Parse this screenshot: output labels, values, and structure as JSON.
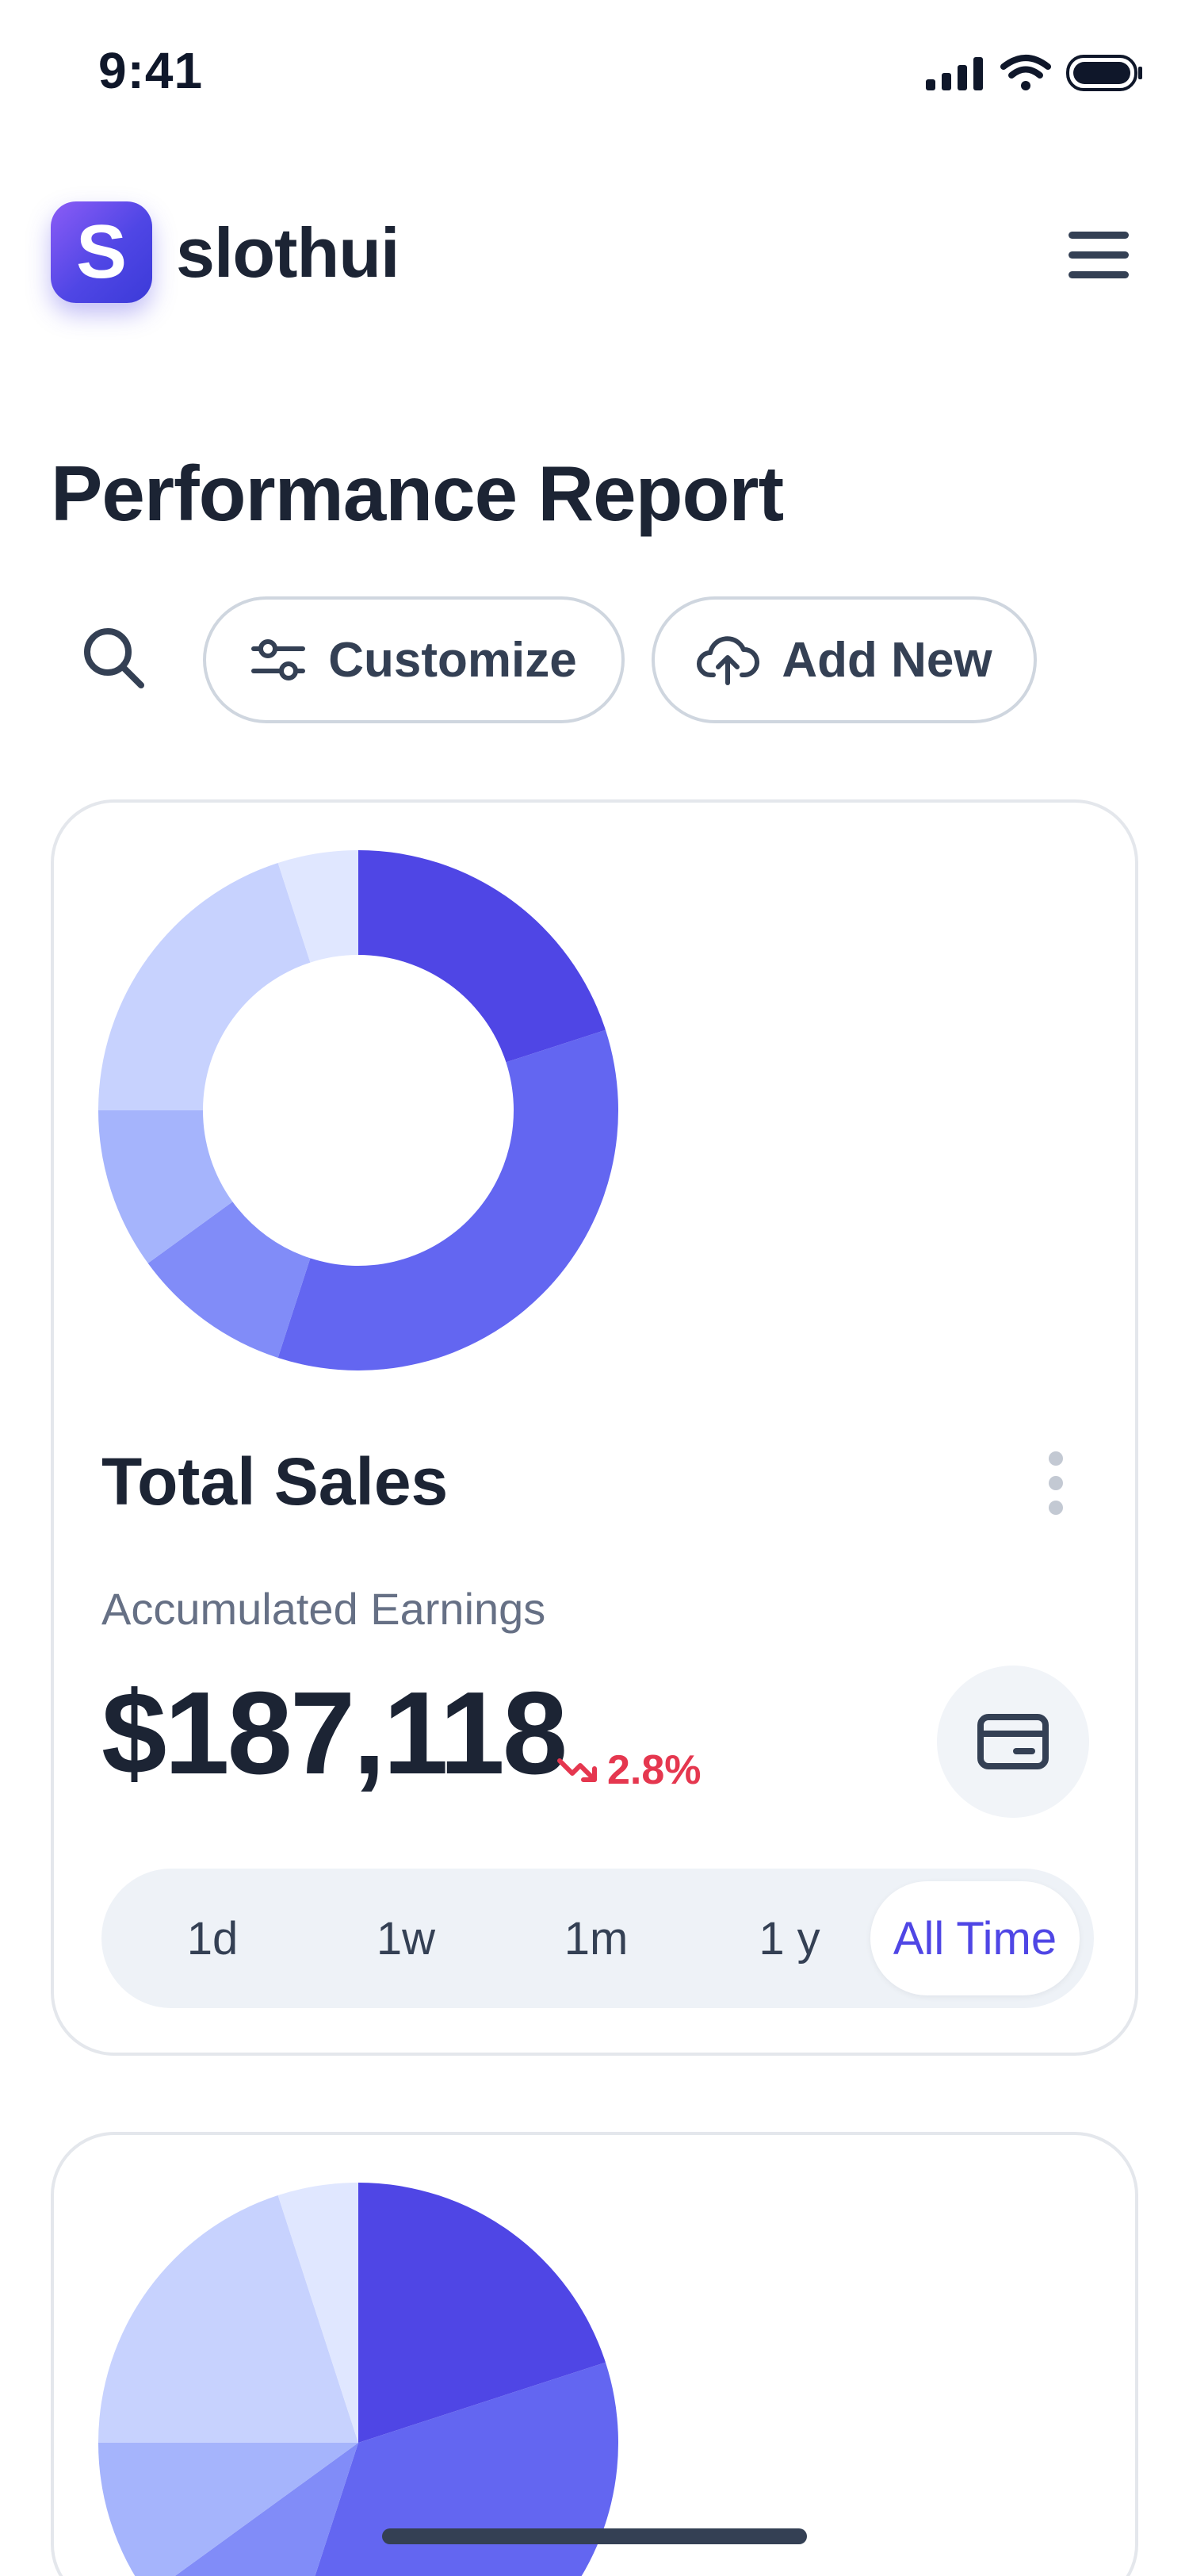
{
  "status_bar": {
    "time": "9:41"
  },
  "header": {
    "brand_letter": "S",
    "brand_name": "slothui"
  },
  "page": {
    "title": "Performance Report"
  },
  "toolbar": {
    "customize_label": "Customize",
    "add_new_label": "Add New"
  },
  "sales_card": {
    "title": "Total Sales",
    "subtitle": "Accumulated Earnings",
    "amount": "$187,118",
    "change": {
      "direction": "down",
      "value": "2.8%",
      "color": "#e5374f"
    },
    "time_ranges": [
      "1d",
      "1w",
      "1m",
      "1 y",
      "All Time"
    ],
    "selected_range": "All Time"
  },
  "chart_data": [
    {
      "type": "pie",
      "variant": "donut",
      "title": "",
      "slices": [
        {
          "value": 20,
          "color": "#4f46e5"
        },
        {
          "value": 35,
          "color": "#6366f1"
        },
        {
          "value": 10,
          "color": "#818cf8"
        },
        {
          "value": 10,
          "color": "#a5b4fc"
        },
        {
          "value": 20,
          "color": "#c7d2fe"
        },
        {
          "value": 5,
          "color": "#e0e7ff"
        }
      ]
    },
    {
      "type": "pie",
      "title": "",
      "slices": [
        {
          "value": 20,
          "color": "#4f46e5"
        },
        {
          "value": 35,
          "color": "#6366f1"
        },
        {
          "value": 10,
          "color": "#818cf8"
        },
        {
          "value": 10,
          "color": "#a5b4fc"
        },
        {
          "value": 20,
          "color": "#c7d2fe"
        },
        {
          "value": 5,
          "color": "#e0e7ff"
        }
      ]
    }
  ],
  "colors": {
    "accent": "#4f46e5",
    "text": "#1c2434",
    "muted": "#667085",
    "negative": "#e5374f"
  }
}
